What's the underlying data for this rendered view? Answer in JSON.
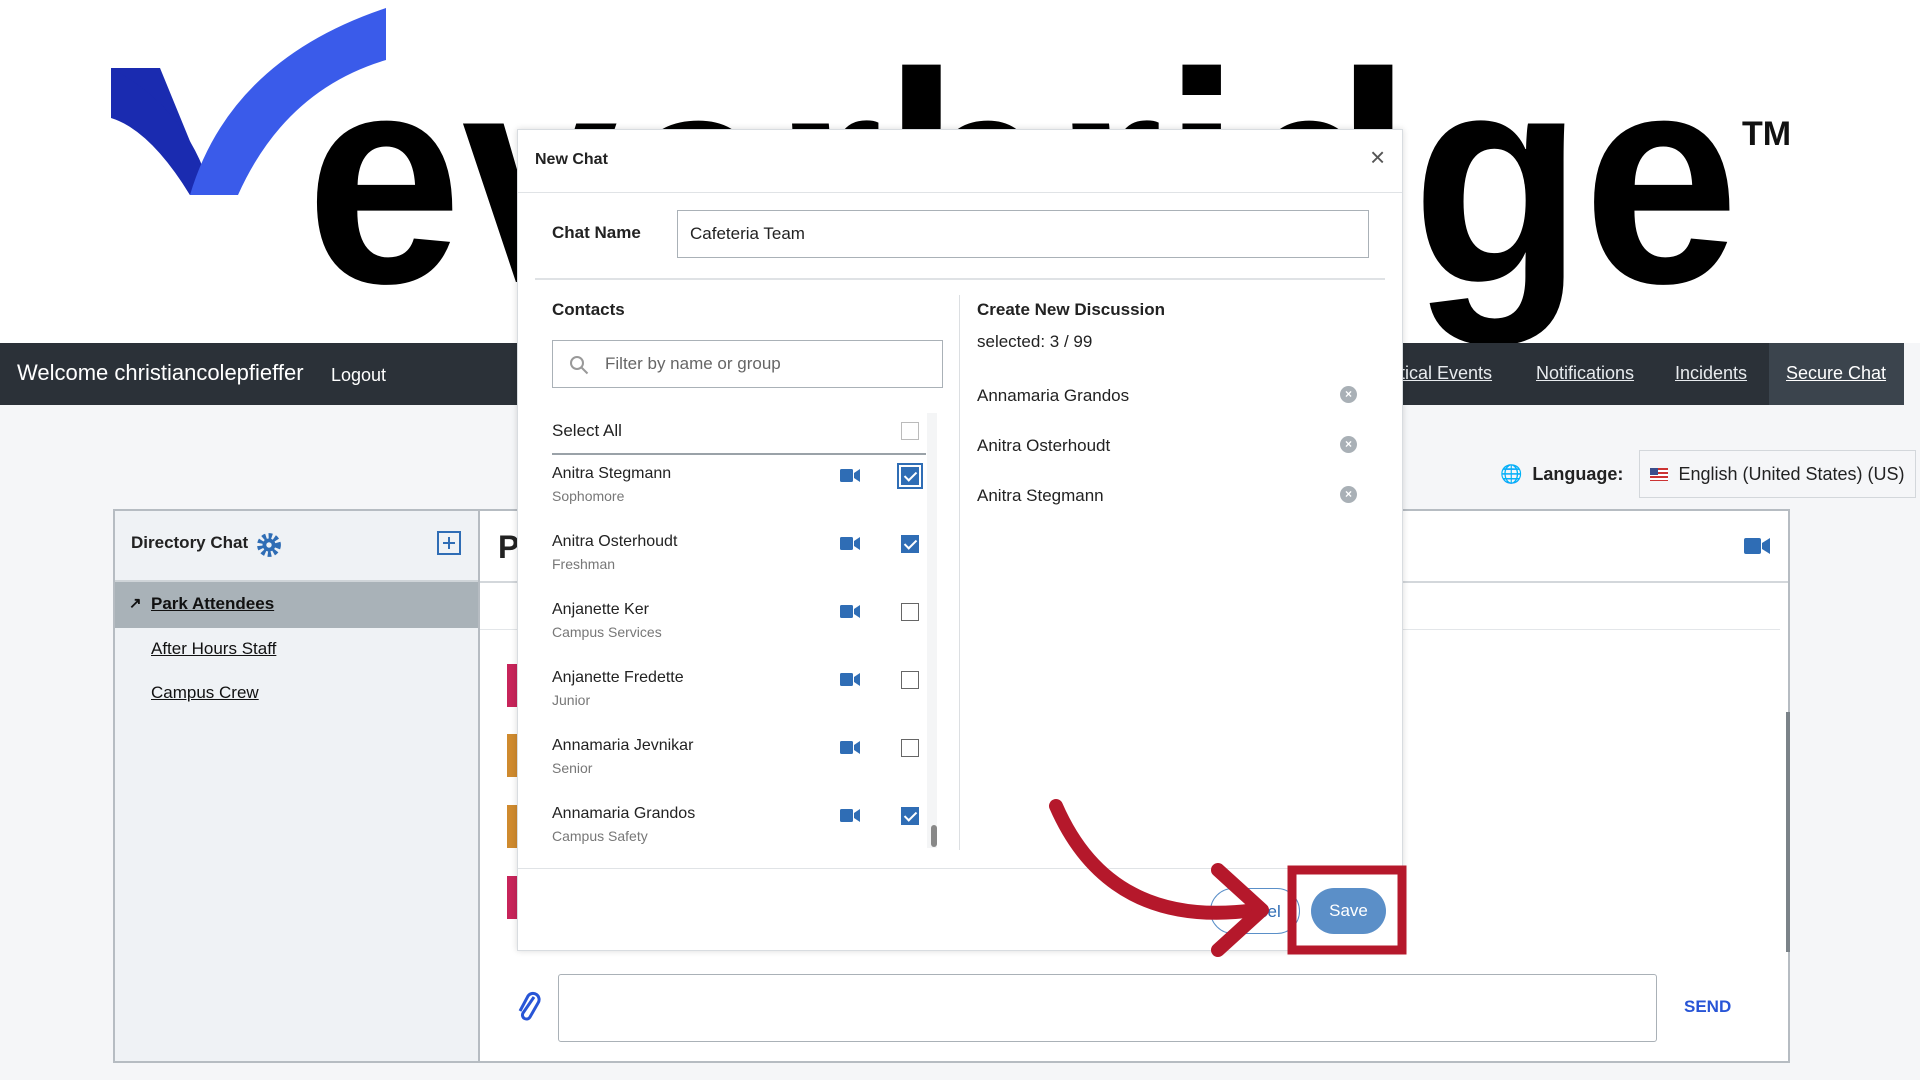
{
  "logo": {
    "text": "everbridge",
    "tm": "TM",
    "colors": {
      "check_dark": "#1a2bb0",
      "check_light": "#3a5bea"
    }
  },
  "nav": {
    "welcome": "Welcome christiancolepfieffer",
    "logout": "Logout",
    "links": [
      "itical Events",
      "Notifications",
      "Incidents",
      "Secure Chat"
    ],
    "active": "Secure Chat"
  },
  "language": {
    "label": "Language:",
    "value": "English (United States) (US)"
  },
  "sidebar": {
    "title": "Directory Chat",
    "items": [
      "Park Attendees",
      "After Hours Staff",
      "Campus Crew"
    ],
    "selected": "Park Attendees"
  },
  "chat": {
    "title_initial": "P",
    "send": "SEND",
    "message_placeholder": ""
  },
  "modal": {
    "title": "New Chat",
    "close": "×",
    "chat_name_label": "Chat Name",
    "chat_name_value": "Cafeteria Team",
    "contacts_label": "Contacts",
    "filter_placeholder": "Filter by name or group",
    "select_all": "Select All",
    "contacts": [
      {
        "name": "Anitra Stegmann",
        "sub": "Sophomore",
        "checked": true
      },
      {
        "name": "Anitra Osterhoudt",
        "sub": "Freshman",
        "checked": true
      },
      {
        "name": "Anjanette Ker",
        "sub": "Campus Services",
        "checked": false
      },
      {
        "name": "Anjanette Fredette",
        "sub": "Junior",
        "checked": false
      },
      {
        "name": "Annamaria Jevnikar",
        "sub": "Senior",
        "checked": false
      },
      {
        "name": "Annamaria Grandos",
        "sub": "Campus Safety",
        "checked": true
      }
    ],
    "discussion_title": "Create New Discussion",
    "selected_count": "selected: 3 / 99",
    "selected": [
      "Annamaria Grandos",
      "Anitra Osterhoudt",
      "Anitra Stegmann"
    ],
    "cancel": "cel",
    "save": "Save"
  },
  "annotation": {
    "color": "#b5182b"
  }
}
